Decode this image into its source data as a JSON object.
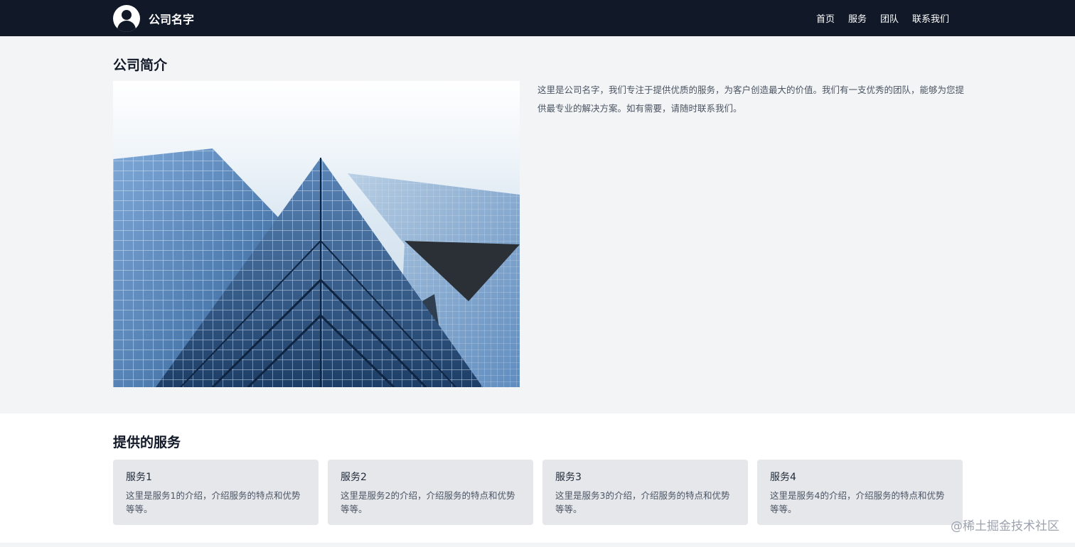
{
  "header": {
    "company_name": "公司名字",
    "nav": [
      "首页",
      "服务",
      "团队",
      "联系我们"
    ]
  },
  "about": {
    "title": "公司简介",
    "text": "这里是公司名字，我们专注于提供优质的服务，为客户创造最大的价值。我们有一支优秀的团队，能够为您提供最专业的解决方案。如有需要，请随时联系我们。"
  },
  "services": {
    "title": "提供的服务",
    "cards": [
      {
        "title": "服务1",
        "desc": "这里是服务1的介绍，介绍服务的特点和优势等等。"
      },
      {
        "title": "服务2",
        "desc": "这里是服务2的介绍，介绍服务的特点和优势等等。"
      },
      {
        "title": "服务3",
        "desc": "这里是服务3的介绍，介绍服务的特点和优势等等。"
      },
      {
        "title": "服务4",
        "desc": "这里是服务4的介绍，介绍服务的特点和优势等等。"
      }
    ]
  },
  "watermark": "@稀土掘金技术社区",
  "colors": {
    "nav_background": "#111827",
    "page_background": "#f3f4f6",
    "card_background": "#e5e7eb"
  }
}
